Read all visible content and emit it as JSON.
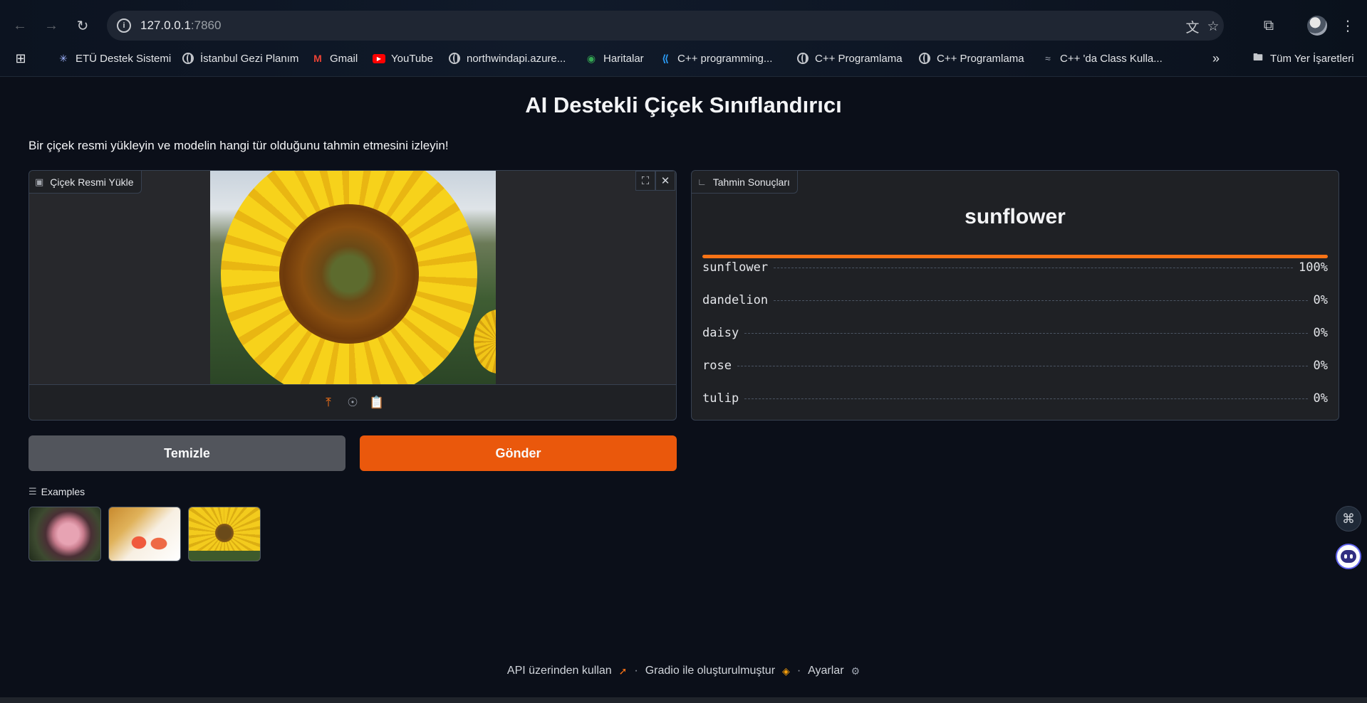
{
  "browser": {
    "url_host": "127.0.0.1",
    "url_port": ":7860",
    "bookmarks": [
      {
        "label": "ETÜ Destek Sistemi",
        "icon": "asterisk-icon"
      },
      {
        "label": "İstanbul Gezi Planım",
        "icon": "globe-icon"
      },
      {
        "label": "Gmail",
        "icon": "gmail-icon"
      },
      {
        "label": "YouTube",
        "icon": "youtube-icon"
      },
      {
        "label": "northwindapi.azure...",
        "icon": "globe-icon"
      },
      {
        "label": "Haritalar",
        "icon": "maps-icon"
      },
      {
        "label": "C++ programming...",
        "icon": "vscode-icon"
      },
      {
        "label": "C++ Programlama",
        "icon": "globe-icon"
      },
      {
        "label": "C++ Programlama",
        "icon": "globe-icon"
      },
      {
        "label": "C++ 'da Class Kulla...",
        "icon": "feather-icon"
      }
    ],
    "all_bookmarks": "Tüm Yer İşaretleri"
  },
  "app": {
    "title": "AI Destekli Çiçek Sınıflandırıcı",
    "description": "Bir çiçek resmi yükleyin ve modelin hangi tür olduğunu tahmin etmesini izleyin!",
    "input_label": "Çiçek Resmi Yükle",
    "output_label": "Tahmin Sonuçları",
    "predicted_label": "sunflower",
    "confidences": [
      {
        "label": "sunflower",
        "value": 1.0,
        "text": "100%"
      },
      {
        "label": "dandelion",
        "value": 0.0,
        "text": "0%"
      },
      {
        "label": "daisy",
        "value": 0.0,
        "text": "0%"
      },
      {
        "label": "rose",
        "value": 0.0,
        "text": "0%"
      },
      {
        "label": "tulip",
        "value": 0.0,
        "text": "0%"
      }
    ],
    "clear_button": "Temizle",
    "submit_button": "Gönder",
    "examples_label": "Examples",
    "accent_color": "#f97316"
  },
  "footer": {
    "api": "API üzerinden kullan",
    "built_with": "Gradio ile oluşturulmuştur",
    "settings": "Ayarlar"
  }
}
